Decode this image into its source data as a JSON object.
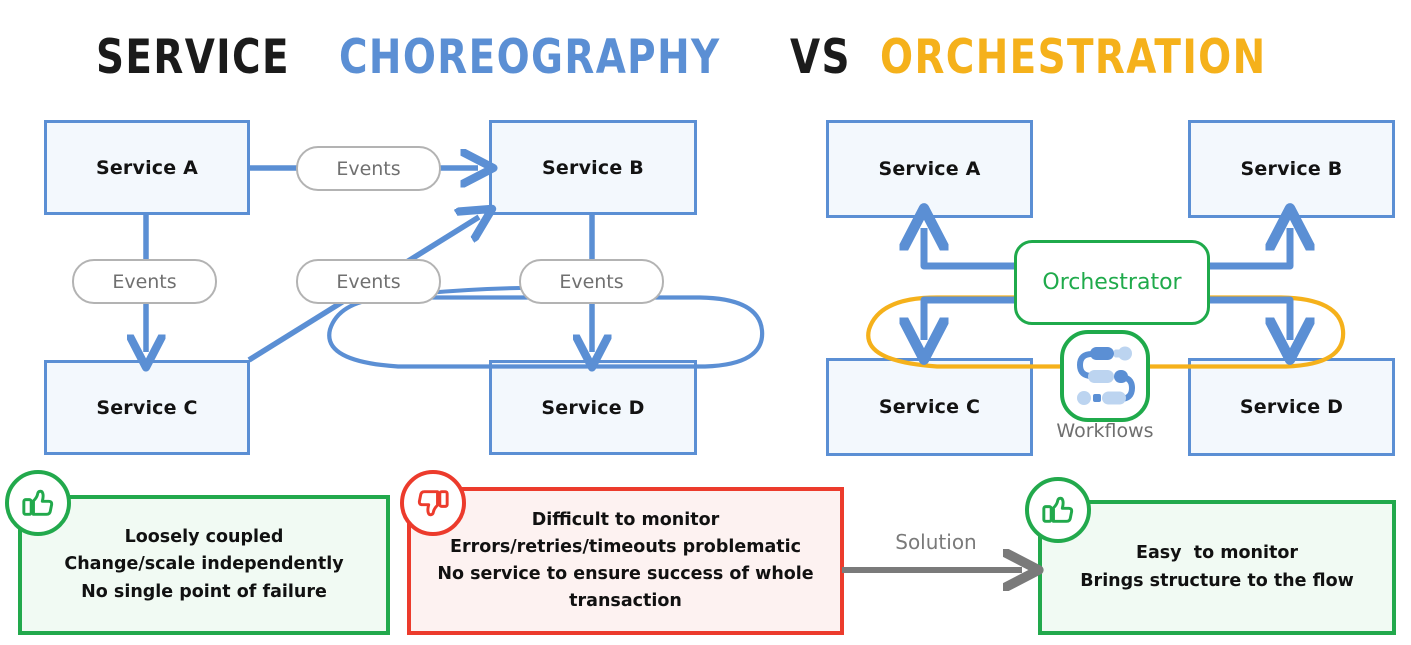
{
  "title": {
    "plain_left": "SERVICE",
    "highlight_left": "CHOREOGRAPHY",
    "plain_mid": "VS",
    "highlight_right": "ORCHESTRATION",
    "color_left": "#5b8fd4",
    "color_right": "#f5b11b",
    "color_plain": "#1b1b1b"
  },
  "choreography": {
    "services": [
      {
        "id": "a",
        "label": "Service A"
      },
      {
        "id": "b",
        "label": "Service B"
      },
      {
        "id": "c",
        "label": "Service C"
      },
      {
        "id": "d",
        "label": "Service D"
      }
    ],
    "event_pills": [
      {
        "id": "a-to-b",
        "label": "Events"
      },
      {
        "id": "a-to-c",
        "label": "Events"
      },
      {
        "id": "c-to-b",
        "label": "Events"
      },
      {
        "id": "b-to-d",
        "label": "Events"
      }
    ],
    "box_fill": "#f3f8fd",
    "box_border": "#5b8fd4",
    "pill_border": "#b3b3b3",
    "pill_text": "#707070"
  },
  "orchestration": {
    "services": [
      {
        "id": "a",
        "label": "Service A"
      },
      {
        "id": "b",
        "label": "Service B"
      },
      {
        "id": "c",
        "label": "Service C"
      },
      {
        "id": "d",
        "label": "Service D"
      }
    ],
    "orchestrator_label": "Orchestrator",
    "workflows_label": "Workflows",
    "accent": "#1faa4b",
    "arrow_color": "#5b8fd4"
  },
  "callouts": {
    "pros": {
      "icon": "thumbs-up-icon",
      "color": "#22a94c",
      "fill": "#f1faf3",
      "lines": [
        "Loosely coupled",
        "Change/scale independently",
        "No single point of failure"
      ]
    },
    "cons": {
      "icon": "thumbs-down-icon",
      "color": "#ec3b2c",
      "fill": "#fdf2f1",
      "lines": [
        "Difficult to monitor",
        "Errors/retries/timeouts problematic",
        "No service to ensure success of whole",
        "transaction"
      ]
    },
    "solution": {
      "icon": "thumbs-up-icon",
      "color": "#22a94c",
      "fill": "#f1faf3",
      "arrow_label": "Solution",
      "arrow_color": "#7a7a7a",
      "lines": [
        "Easy  to monitor",
        "Brings structure to the flow"
      ]
    }
  }
}
